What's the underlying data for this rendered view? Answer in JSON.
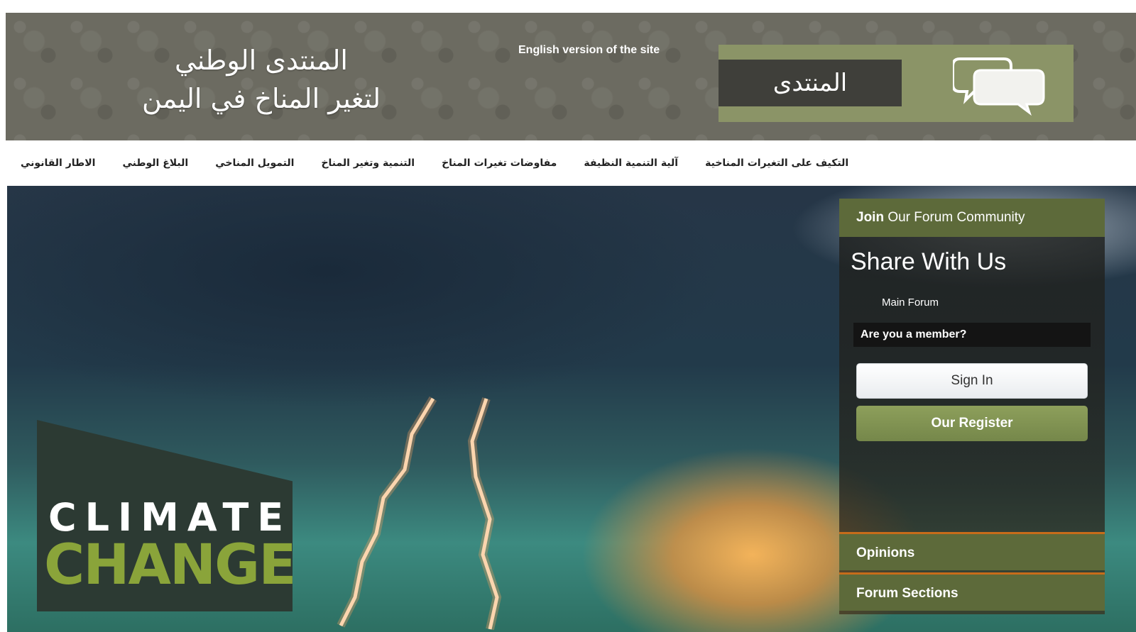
{
  "header": {
    "site_title_line1": "المنتدى الوطني",
    "site_title_line2": "لتغير المناخ في اليمن",
    "english_link": "English version of the site",
    "forum_banner_label": "المنتدى"
  },
  "nav": {
    "items": [
      "الاطار القانوني",
      "البلاغ الوطني",
      "التمويل المناخي",
      "التنمية وتغير المناخ",
      "مفاوضات تغيرات المناخ",
      "آلية التنمية النظيفة",
      "التكيف على التغيرات المناخية"
    ]
  },
  "hero": {
    "climate_word": "CLIMATE",
    "change_word": "CHANGE"
  },
  "widget": {
    "header_bold": "Join",
    "header_rest": " Our Forum Community",
    "share_title": "Share With Us",
    "main_forum": "Main Forum",
    "member_question": "Are you a member?",
    "signin_label": "Sign In",
    "register_label": "Our Register",
    "tab_opinions": "Opinions",
    "tab_sections": "Forum Sections"
  },
  "colors": {
    "header_bg": "#6c6b61",
    "banner_green": "#8b9467",
    "widget_green": "#5d6a3a",
    "accent_orange": "#c76c1a",
    "change_green": "#8aa43a"
  },
  "icons": [
    "chat-bubbles-icon",
    "lightning-icon"
  ]
}
